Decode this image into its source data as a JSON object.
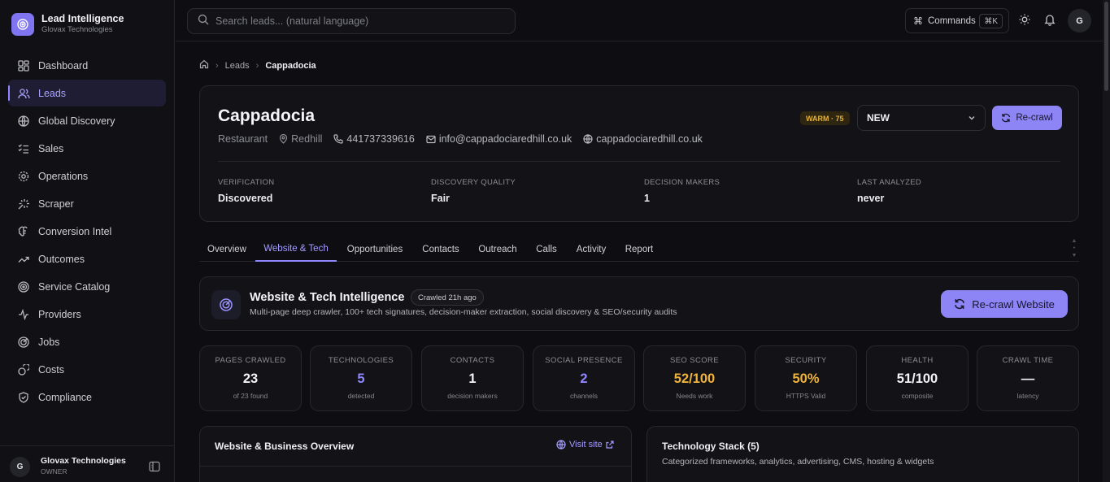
{
  "brand": {
    "title": "Lead Intelligence",
    "subtitle": "Glovax Technologies"
  },
  "nav": [
    {
      "label": "Dashboard",
      "icon": "grid-icon"
    },
    {
      "label": "Leads",
      "icon": "users-icon",
      "active": true
    },
    {
      "label": "Global Discovery",
      "icon": "globe-icon"
    },
    {
      "label": "Sales",
      "icon": "list-check-icon"
    },
    {
      "label": "Operations",
      "icon": "gear-icon"
    },
    {
      "label": "Scraper",
      "icon": "sparkle-icon"
    },
    {
      "label": "Conversion Intel",
      "icon": "brain-icon"
    },
    {
      "label": "Outcomes",
      "icon": "trend-up-icon"
    },
    {
      "label": "Service Catalog",
      "icon": "target-icon"
    },
    {
      "label": "Providers",
      "icon": "pulse-icon"
    },
    {
      "label": "Jobs",
      "icon": "radar-icon"
    },
    {
      "label": "Costs",
      "icon": "coins-icon"
    },
    {
      "label": "Compliance",
      "icon": "shield-icon"
    }
  ],
  "footer": {
    "avatar": "G",
    "name": "Glovax Technologies",
    "role": "OWNER"
  },
  "topbar": {
    "search_placeholder": "Search leads... (natural language)",
    "commands_label": "Commands",
    "commands_key": "⌘K",
    "avatar": "G"
  },
  "breadcrumb": {
    "item1": "Leads",
    "current": "Cappadocia"
  },
  "lead": {
    "name": "Cappadocia",
    "category": "Restaurant",
    "location": "Redhill",
    "phone": "441737339616",
    "email": "info@cappadociaredhill.co.uk",
    "website": "cappadociaredhill.co.uk",
    "temperature_badge": "WARM · 75",
    "status": "NEW",
    "recrawl_label": "Re-crawl",
    "stats": [
      {
        "label": "VERIFICATION",
        "value": "Discovered"
      },
      {
        "label": "DISCOVERY QUALITY",
        "value": "Fair"
      },
      {
        "label": "DECISION MAKERS",
        "value": "1"
      },
      {
        "label": "LAST ANALYZED",
        "value": "never"
      }
    ]
  },
  "tabs": [
    "Overview",
    "Website & Tech",
    "Opportunities",
    "Contacts",
    "Outreach",
    "Calls",
    "Activity",
    "Report"
  ],
  "active_tab": "Website & Tech",
  "intel": {
    "title": "Website & Tech Intelligence",
    "badge": "Crawled 21h ago",
    "subtitle": "Multi-page deep crawler, 100+ tech signatures, decision-maker extraction, social discovery & SEO/security audits",
    "button": "Re-crawl Website"
  },
  "metrics": [
    {
      "label": "PAGES CRAWLED",
      "value": "23",
      "sub": "of 23 found",
      "color": "#f4f4f6"
    },
    {
      "label": "TECHNOLOGIES",
      "value": "5",
      "sub": "detected",
      "color": "#8f87ff"
    },
    {
      "label": "CONTACTS",
      "value": "1",
      "sub": "decision makers",
      "color": "#f4f4f6"
    },
    {
      "label": "SOCIAL PRESENCE",
      "value": "2",
      "sub": "channels",
      "color": "#8f87ff"
    },
    {
      "label": "SEO SCORE",
      "value": "52/100",
      "sub": "Needs work",
      "color": "#f0b33a"
    },
    {
      "label": "SECURITY",
      "value": "50%",
      "sub": "HTTPS Valid",
      "color": "#f0b33a"
    },
    {
      "label": "HEALTH",
      "value": "51/100",
      "sub": "composite",
      "color": "#f4f4f6"
    },
    {
      "label": "CRAWL TIME",
      "value": "—",
      "sub": "latency",
      "color": "#f4f4f6"
    }
  ],
  "overview": {
    "title": "Website & Business Overview",
    "visit": "Visit site"
  },
  "tech": {
    "title": "Technology Stack (5)",
    "subtitle": "Categorized frameworks, analytics, advertising, CMS, hosting & widgets"
  },
  "colors": {
    "accent": "#8f87ff",
    "button": "#8d85f5",
    "warm": "#e5b33b",
    "background": "#0e0e12"
  }
}
